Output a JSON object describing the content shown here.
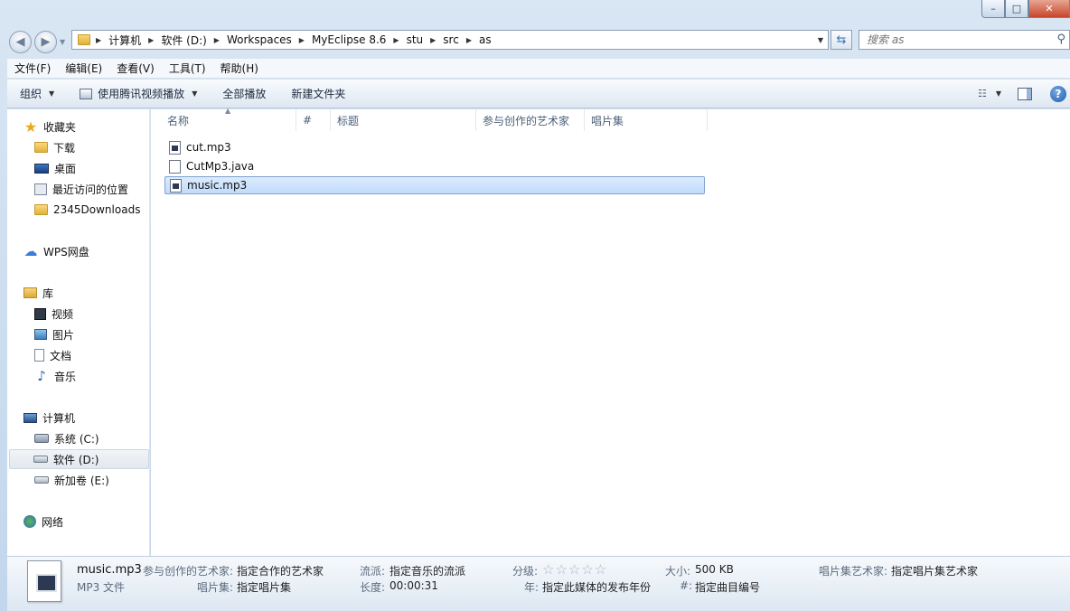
{
  "window": {
    "controls": {
      "minimize": "–",
      "maximize": "□",
      "close": "✕"
    }
  },
  "addressbar": {
    "crumbs": [
      "计算机",
      "软件 (D:)",
      "Workspaces",
      "MyEclipse 8.6",
      "stu",
      "src",
      "as"
    ],
    "search_placeholder": "搜索 as",
    "icons": [
      "back-icon",
      "forward-icon",
      "folder-icon",
      "refresh-icon",
      "search-icon"
    ]
  },
  "menubar": [
    "文件(F)",
    "编辑(E)",
    "查看(V)",
    "工具(T)",
    "帮助(H)"
  ],
  "commandbar": {
    "organize": "组织",
    "play_with": "使用腾讯视频播放",
    "play_all": "全部播放",
    "new_folder": "新建文件夹"
  },
  "navpane": {
    "favorites": {
      "label": "收藏夹",
      "items": [
        "下载",
        "桌面",
        "最近访问的位置",
        "2345Downloads"
      ]
    },
    "wps": "WPS网盘",
    "libraries": {
      "label": "库",
      "items": [
        "视频",
        "图片",
        "文档",
        "音乐"
      ]
    },
    "computer": {
      "label": "计算机",
      "items": [
        "系统 (C:)",
        "软件 (D:)",
        "新加卷 (E:)"
      ],
      "selected": "软件 (D:)"
    },
    "network": "网络"
  },
  "columns": [
    "名称",
    "#",
    "标题",
    "参与创作的艺术家",
    "唱片集"
  ],
  "files": [
    {
      "name": "cut.mp3",
      "type": "media"
    },
    {
      "name": "CutMp3.java",
      "type": "plain"
    },
    {
      "name": "music.mp3",
      "type": "media",
      "selected": true
    }
  ],
  "details": {
    "name": "music.mp3",
    "type": "MP3 文件",
    "artist_label": "参与创作的艺术家:",
    "artist_value": "指定合作的艺术家",
    "album_label": "唱片集:",
    "album_value": "指定唱片集",
    "genre_label": "流派:",
    "genre_value": "指定音乐的流派",
    "length_label": "长度:",
    "length_value": "00:00:31",
    "rating_label": "分级:",
    "rating_stars": "☆☆☆☆☆",
    "year_label": "年:",
    "year_value": "指定此媒体的发布年份",
    "size_label": "大小:",
    "size_value": "500 KB",
    "track_label": "#:",
    "track_value": "指定曲目编号",
    "album_artist_label": "唱片集艺术家:",
    "album_artist_value": "指定唱片集艺术家"
  }
}
